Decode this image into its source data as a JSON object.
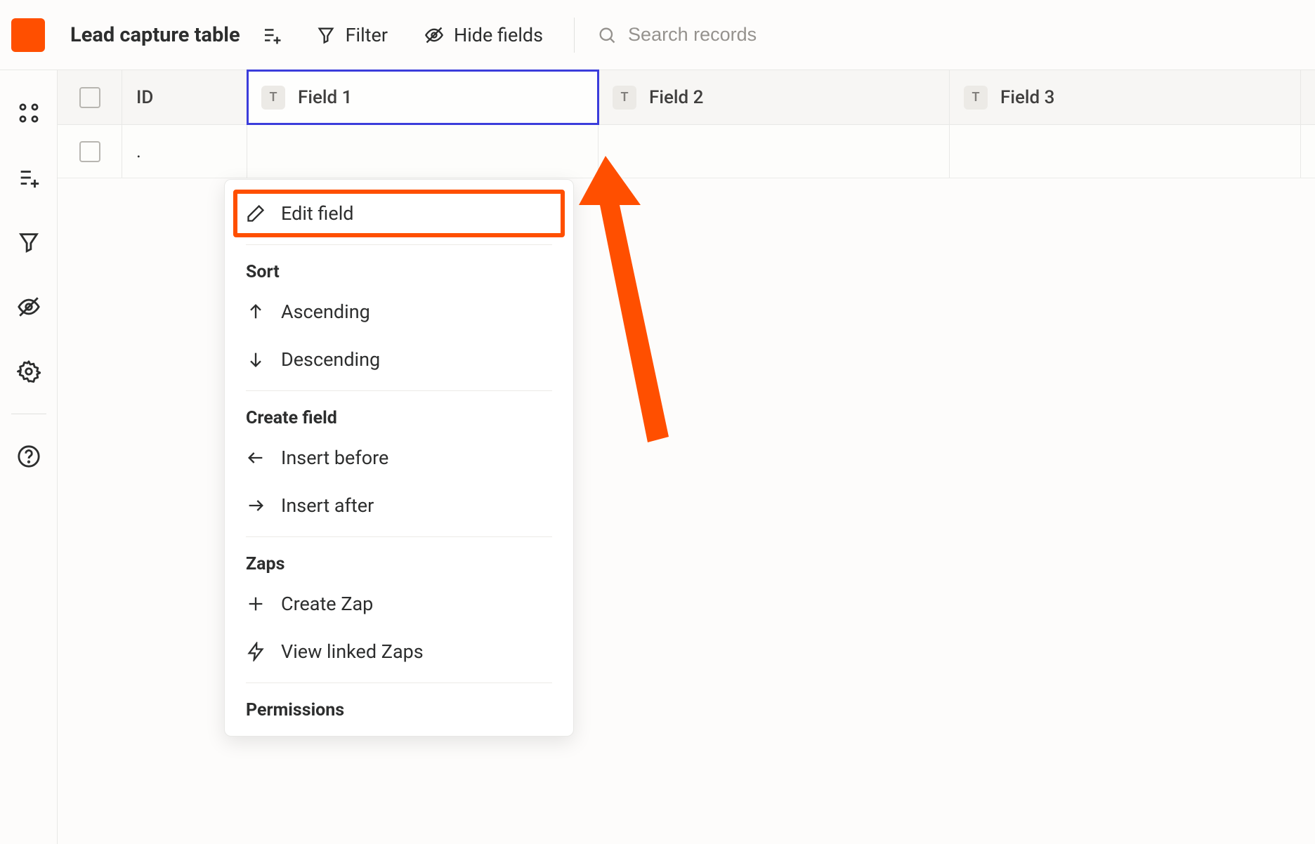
{
  "toolbar": {
    "table_name": "Lead capture table",
    "filter_label": "Filter",
    "hide_fields_label": "Hide fields",
    "search_placeholder": "Search records"
  },
  "columns": {
    "id_label": "ID",
    "fields": [
      {
        "label": "Field 1",
        "type": "T"
      },
      {
        "label": "Field 2",
        "type": "T"
      },
      {
        "label": "Field 3",
        "type": "T"
      }
    ]
  },
  "rows": [
    {
      "id": "."
    }
  ],
  "context_menu": {
    "edit_field": "Edit field",
    "sort_section": "Sort",
    "ascending": "Ascending",
    "descending": "Descending",
    "create_field_section": "Create field",
    "insert_before": "Insert before",
    "insert_after": "Insert after",
    "zaps_section": "Zaps",
    "create_zap": "Create Zap",
    "view_linked_zaps": "View linked Zaps",
    "permissions_section": "Permissions"
  },
  "colors": {
    "accent": "#ff4f00",
    "active_outline": "#3b3ddb"
  }
}
